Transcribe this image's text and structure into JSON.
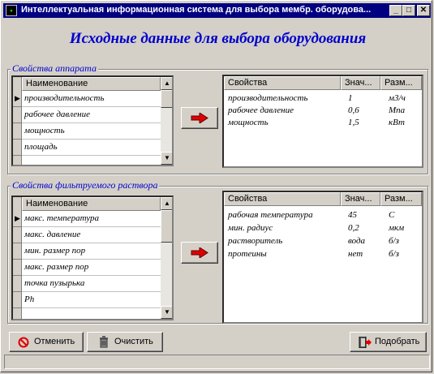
{
  "window": {
    "title": "Интеллектуальная информационная система для выбора мембр. оборудова...",
    "min_glyph": "_",
    "max_glyph": "□",
    "close_glyph": "✕"
  },
  "heading": "Исходные данные для выбора оборудования",
  "apparatus": {
    "group_label": "Свойства аппарата",
    "list_header": "Наименование",
    "items": [
      "производительность",
      "рабочее давление",
      "мощность",
      "площадь"
    ],
    "props_headers": [
      "Свойства",
      "Знач...",
      "Разм..."
    ],
    "props": [
      {
        "name": "производительность",
        "value": "1",
        "unit": "м3/ч"
      },
      {
        "name": "рабочее давление",
        "value": "0,6",
        "unit": "Мпа"
      },
      {
        "name": "мощность",
        "value": "1,5",
        "unit": "кВт"
      }
    ]
  },
  "filtered": {
    "group_label": "Свойства фильтруемого раствора",
    "list_header": "Наименование",
    "items": [
      "макс. температура",
      "макс. давление",
      "мин. размер пор",
      "макс. размер пор",
      "точка пузырька",
      "Ph"
    ],
    "props_headers": [
      "Свойства",
      "Знач...",
      "Разм..."
    ],
    "props": [
      {
        "name": "рабочая температура",
        "value": "45",
        "unit": "С"
      },
      {
        "name": "мин. радиус",
        "value": "0,2",
        "unit": "мкм"
      },
      {
        "name": "растворитель",
        "value": "вода",
        "unit": "б/з"
      },
      {
        "name": "протеины",
        "value": "нет",
        "unit": "б/з"
      }
    ]
  },
  "buttons": {
    "cancel": "Отменить",
    "clear": "Очистить",
    "select": "Подобрать"
  },
  "icons": {
    "cancel": "cancel-icon",
    "clear": "trash-icon",
    "select": "exit-door-icon",
    "add": "red-arrow-right-icon",
    "row_pointer": "row-pointer-icon"
  },
  "colors": {
    "title_bar": "#000080",
    "heading": "#0000cc",
    "arrow": "#e00000"
  }
}
